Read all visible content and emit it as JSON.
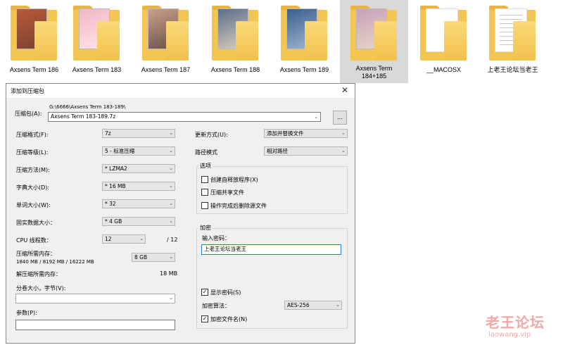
{
  "explorer": {
    "items": [
      {
        "name": "Axsens Term 186",
        "kind": "images",
        "colors": [
          "#b85a3a",
          "#7a4130"
        ],
        "selected": false
      },
      {
        "name": "Axsens Term 183",
        "kind": "images",
        "colors": [
          "#f2b7c6",
          "#ffe3ea"
        ],
        "selected": false
      },
      {
        "name": "Axsens Term 187",
        "kind": "images",
        "colors": [
          "#c9a08a",
          "#6a5147"
        ],
        "selected": false
      },
      {
        "name": "Axsens Term 188",
        "kind": "images",
        "colors": [
          "#5b6f8a",
          "#d9cdbd"
        ],
        "selected": false
      },
      {
        "name": "Axsens Term 189",
        "kind": "images",
        "colors": [
          "#3c5f8f",
          "#9fb6cf"
        ],
        "selected": false
      },
      {
        "name": "Axsens Term 184+185",
        "kind": "images",
        "colors": [
          "#c8a0b8",
          "#e8d7c8"
        ],
        "selected": true
      },
      {
        "name": "__MACOSX",
        "kind": "empty",
        "colors": [],
        "selected": false
      },
      {
        "name": "上老王论坛当老王",
        "kind": "docs",
        "colors": [],
        "selected": false
      }
    ]
  },
  "dialog": {
    "title": "添加到压缩包",
    "close_glyph": "✕",
    "archive": {
      "label": "压缩包(A):",
      "path": "G:\\6666\\Axsens Term 183-189\\",
      "name": "Axsens Term 183-189.7z",
      "browse_label": "..."
    },
    "format": {
      "label": "压缩格式(F):",
      "value": "7z"
    },
    "level": {
      "label": "压缩等级(L):",
      "value": "5 - 标准压缩"
    },
    "method": {
      "label": "压缩方法(M):",
      "value": "* LZMA2"
    },
    "dict": {
      "label": "字典大小(D):",
      "value": "* 16 MB"
    },
    "word": {
      "label": "单词大小(W):",
      "value": "* 32"
    },
    "solid": {
      "label": "固实数据大小：",
      "value": "* 4 GB"
    },
    "threads": {
      "label": "CPU 线程数：",
      "value": "12",
      "max": "/ 12"
    },
    "memory": {
      "label": "压缩所需内存：",
      "detail": "1840 MB / 8192 MB / 16222 MB",
      "limit": "8 GB"
    },
    "decompress_memory": {
      "label": "解压缩所需内存：",
      "value": "18 MB"
    },
    "volume": {
      "label": "分卷大小，字节(V):",
      "value": ""
    },
    "params": {
      "label": "参数(P):",
      "value": ""
    },
    "update": {
      "label": "更新方式(U):",
      "value": "添加并替换文件"
    },
    "path_mode": {
      "label": "路径模式",
      "value": "相对路径"
    },
    "options": {
      "title": "选项",
      "items": [
        {
          "label": "创建自释放程序(X)",
          "checked": false
        },
        {
          "label": "压缩共享文件",
          "checked": false
        },
        {
          "label": "操作完成后删除源文件",
          "checked": false
        }
      ]
    },
    "encryption": {
      "title": "加密",
      "password_label": "输入密码：",
      "password": "上老王论坛当老王",
      "show_password": {
        "label": "显示密码(S)",
        "checked": true
      },
      "method_label": "加密算法：",
      "method": "AES-256",
      "encrypt_names": {
        "label": "加密文件名(N)",
        "checked": true
      }
    }
  },
  "watermark": {
    "text": "老王论坛",
    "sub": "laowang.vip"
  }
}
